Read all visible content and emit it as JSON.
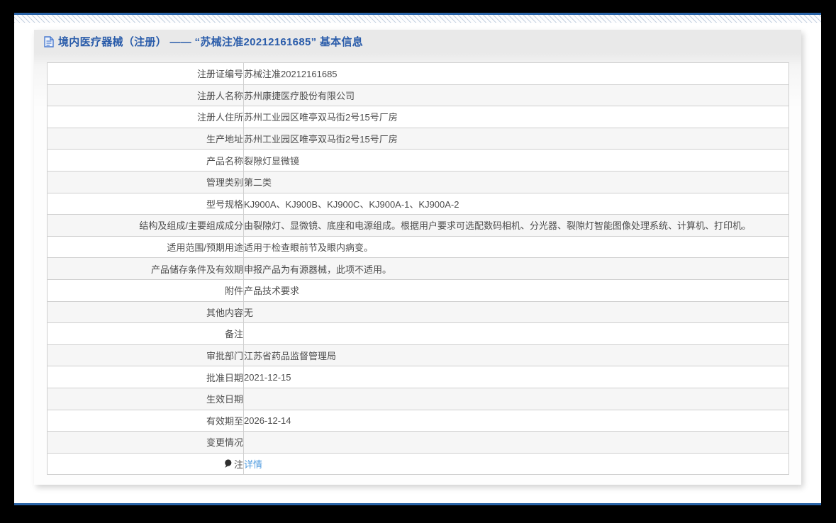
{
  "header": {
    "title": "境内医疗器械（注册） —— “苏械注准20212161685” 基本信息",
    "title_icon": "document-icon"
  },
  "colors": {
    "title_blue": "#2a5caa",
    "edge_line_blue": "#2a64a8",
    "link_blue": "#4f9bdf",
    "alt_row_gray": "#f6f6f6",
    "title_bar_gray": "#e9e9e9"
  },
  "table": {
    "rows": [
      {
        "label": "注册证编号",
        "value": "苏械注准20212161685"
      },
      {
        "label": "注册人名称",
        "value": "苏州康捷医疗股份有限公司"
      },
      {
        "label": "注册人住所",
        "value": "苏州工业园区唯亭双马街2号15号厂房"
      },
      {
        "label": "生产地址",
        "value": "苏州工业园区唯亭双马街2号15号厂房"
      },
      {
        "label": "产品名称",
        "value": "裂隙灯显微镜"
      },
      {
        "label": "管理类别",
        "value": "第二类"
      },
      {
        "label": "型号规格",
        "value": "KJ900A、KJ900B、KJ900C、KJ900A-1、KJ900A-2"
      },
      {
        "label": "结构及组成/主要组成成分",
        "value": "由裂隙灯、显微镜、底座和电源组成。根据用户要求可选配数码相机、分光器、裂隙灯智能图像处理系统、计算机、打印机。"
      },
      {
        "label": "适用范围/预期用途",
        "value": "适用于检查眼前节及眼内病变。"
      },
      {
        "label": "产品储存条件及有效期",
        "value": "申报产品为有源器械，此项不适用。"
      },
      {
        "label": "附件",
        "value": "产品技术要求"
      },
      {
        "label": "其他内容",
        "value": "无"
      },
      {
        "label": "备注",
        "value": ""
      },
      {
        "label": "审批部门",
        "value": "江苏省药品监督管理局"
      },
      {
        "label": "批准日期",
        "value": "2021-12-15"
      },
      {
        "label": "生效日期",
        "value": ""
      },
      {
        "label": "有效期至",
        "value": "2026-12-14"
      },
      {
        "label": "变更情况",
        "value": ""
      },
      {
        "label": "注",
        "value": "详情",
        "value_is_link": true,
        "label_icon": "comment-icon"
      }
    ]
  }
}
